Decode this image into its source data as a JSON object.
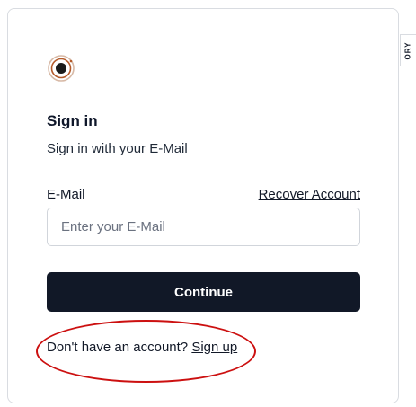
{
  "signin": {
    "title": "Sign in",
    "subtitle": "Sign in with your E-Mail",
    "email_label": "E-Mail",
    "recover_link": "Recover Account",
    "email_placeholder": "Enter your E-Mail",
    "email_value": "",
    "continue_label": "Continue",
    "signup_prompt": "Don't have an account?",
    "signup_link": "Sign up"
  },
  "side_tab": {
    "label": "ORY"
  },
  "icons": {
    "logo": "ory-logo-icon"
  },
  "colors": {
    "primary_button": "#111827",
    "annotation": "#cc1010",
    "logo_accent": "#b45a2a"
  }
}
